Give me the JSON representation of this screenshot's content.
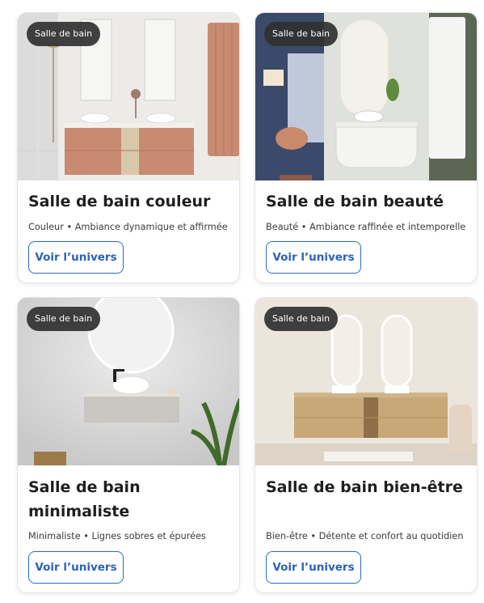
{
  "cards": [
    {
      "badge": "Salle de bain",
      "title": "Salle de bain couleur",
      "description": "Couleur • Ambiance dynamique et affirmée",
      "button": "Voir l’univers"
    },
    {
      "badge": "Salle de bain",
      "title": "Salle de bain beauté",
      "description": "Beauté • Ambiance raffinée et intemporelle",
      "button": "Voir l’univers"
    },
    {
      "badge": "Salle de bain",
      "title": "Salle de bain minimaliste",
      "description": "Minimaliste • Lignes sobres et épurées",
      "button": "Voir l’univers"
    },
    {
      "badge": "Salle de bain",
      "title": "Salle de bain bien-être",
      "description": "Bien-être • Détente et confort au quotidien",
      "button": "Voir l’univers"
    }
  ],
  "colors": {
    "accent": "#2a6bc4",
    "badge_bg": "#303030",
    "title": "#1f1f1f"
  }
}
